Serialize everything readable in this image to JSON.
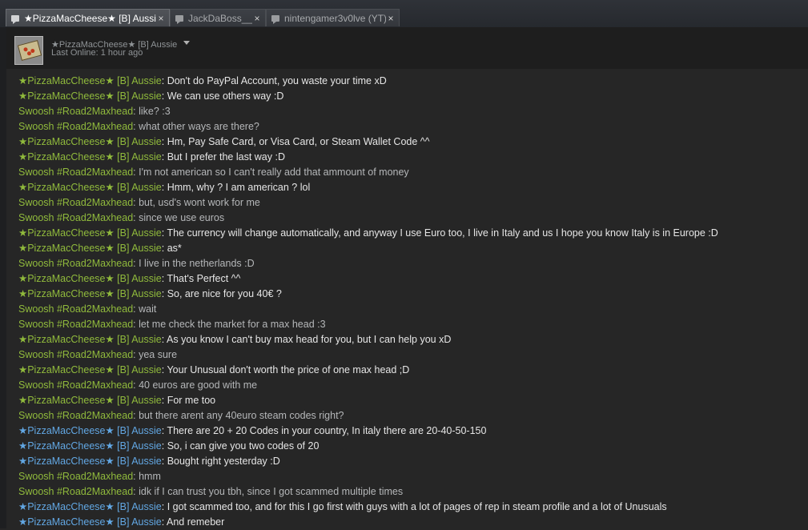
{
  "tabs": [
    {
      "label": "★PizzaMacCheese★ [B] Aussie",
      "active": true,
      "close": "×"
    },
    {
      "label": "JackDaBoss__",
      "active": false,
      "close": "×"
    },
    {
      "label": "nintengamer3v0lve (YT)",
      "active": false,
      "close": "×"
    }
  ],
  "header": {
    "friend_name": "★PizzaMacCheese★ [B] Aussie",
    "status": "Last Online: 1 hour ago"
  },
  "messages": [
    {
      "sender": "★PizzaMacCheese★ [B] Aussie",
      "text": ": Don't do PayPal Account, you waste your time xD",
      "who": "friend"
    },
    {
      "sender": "★PizzaMacCheese★ [B] Aussie",
      "text": ": We can use others way :D",
      "who": "friend"
    },
    {
      "sender": "Swoosh #Road2Maxhead",
      "text": ": like? :3",
      "who": "self"
    },
    {
      "sender": "Swoosh #Road2Maxhead",
      "text": ": what other ways are there?",
      "who": "self"
    },
    {
      "sender": "★PizzaMacCheese★ [B] Aussie",
      "text": ": Hm, Pay Safe Card, or Visa Card, or Steam Wallet Code ^^",
      "who": "friend"
    },
    {
      "sender": "★PizzaMacCheese★ [B] Aussie",
      "text": ": But I prefer the last way :D",
      "who": "friend"
    },
    {
      "sender": "Swoosh #Road2Maxhead",
      "text": ": I'm not american so I can't really add that ammount of money",
      "who": "self"
    },
    {
      "sender": "★PizzaMacCheese★ [B] Aussie",
      "text": ": Hmm, why ? I am american ? lol",
      "who": "friend"
    },
    {
      "sender": "Swoosh #Road2Maxhead",
      "text": ": but, usd's wont work for me",
      "who": "self"
    },
    {
      "sender": "Swoosh #Road2Maxhead",
      "text": ": since we use euros",
      "who": "self"
    },
    {
      "sender": "★PizzaMacCheese★ [B] Aussie",
      "text": ": The currency will change automatically, and anyway I use Euro too, I live in Italy and us I hope you know Italy is in Europe :D",
      "who": "friend"
    },
    {
      "sender": "★PizzaMacCheese★ [B] Aussie",
      "text": ": as*",
      "who": "friend"
    },
    {
      "sender": "Swoosh #Road2Maxhead",
      "text": ": I live in the netherlands :D",
      "who": "self"
    },
    {
      "sender": "★PizzaMacCheese★ [B] Aussie",
      "text": ": That's Perfect ^^",
      "who": "friend"
    },
    {
      "sender": "★PizzaMacCheese★ [B] Aussie",
      "text": ": So, are nice for you 40€ ?",
      "who": "friend"
    },
    {
      "sender": "Swoosh #Road2Maxhead",
      "text": ": wait",
      "who": "self"
    },
    {
      "sender": "Swoosh #Road2Maxhead",
      "text": ": let me check the market for a max head :3",
      "who": "self"
    },
    {
      "sender": "★PizzaMacCheese★ [B] Aussie",
      "text": ": As you know I can't buy max head for you, but I can help you xD",
      "who": "friend"
    },
    {
      "sender": "Swoosh #Road2Maxhead",
      "text": ": yea sure",
      "who": "self"
    },
    {
      "sender": "★PizzaMacCheese★ [B] Aussie",
      "text": ": Your Unusual don't worth the price of one max head ;D",
      "who": "friend"
    },
    {
      "sender": "Swoosh #Road2Maxhead",
      "text": ": 40 euros are good with me",
      "who": "self"
    },
    {
      "sender": "★PizzaMacCheese★ [B] Aussie",
      "text": ": For me too",
      "who": "friend"
    },
    {
      "sender": "Swoosh #Road2Maxhead",
      "text": ": but there arent any 40euro steam codes right?",
      "who": "self"
    },
    {
      "sender": "★PizzaMacCheese★ [B] Aussie",
      "text": ": There are 20 + 20 Codes in your country, In italy there are 20-40-50-150",
      "who": "friend-blue"
    },
    {
      "sender": "★PizzaMacCheese★ [B] Aussie",
      "text": ": So, i can give you two codes of 20",
      "who": "friend-blue"
    },
    {
      "sender": "★PizzaMacCheese★ [B] Aussie",
      "text": ": Bought right yesterday :D",
      "who": "friend-blue"
    },
    {
      "sender": "Swoosh #Road2Maxhead",
      "text": ": hmm",
      "who": "self"
    },
    {
      "sender": "Swoosh #Road2Maxhead",
      "text": ": idk if I can trust you tbh, since I got scammed multiple times",
      "who": "self"
    },
    {
      "sender": "★PizzaMacCheese★ [B] Aussie",
      "text": ": I got scammed too, and for this I go first with guys with a lot of pages of rep in steam profile and a lot of Unusuals",
      "who": "friend-blue"
    },
    {
      "sender": "★PizzaMacCheese★ [B] Aussie",
      "text": ": And remeber",
      "who": "friend-blue"
    }
  ]
}
